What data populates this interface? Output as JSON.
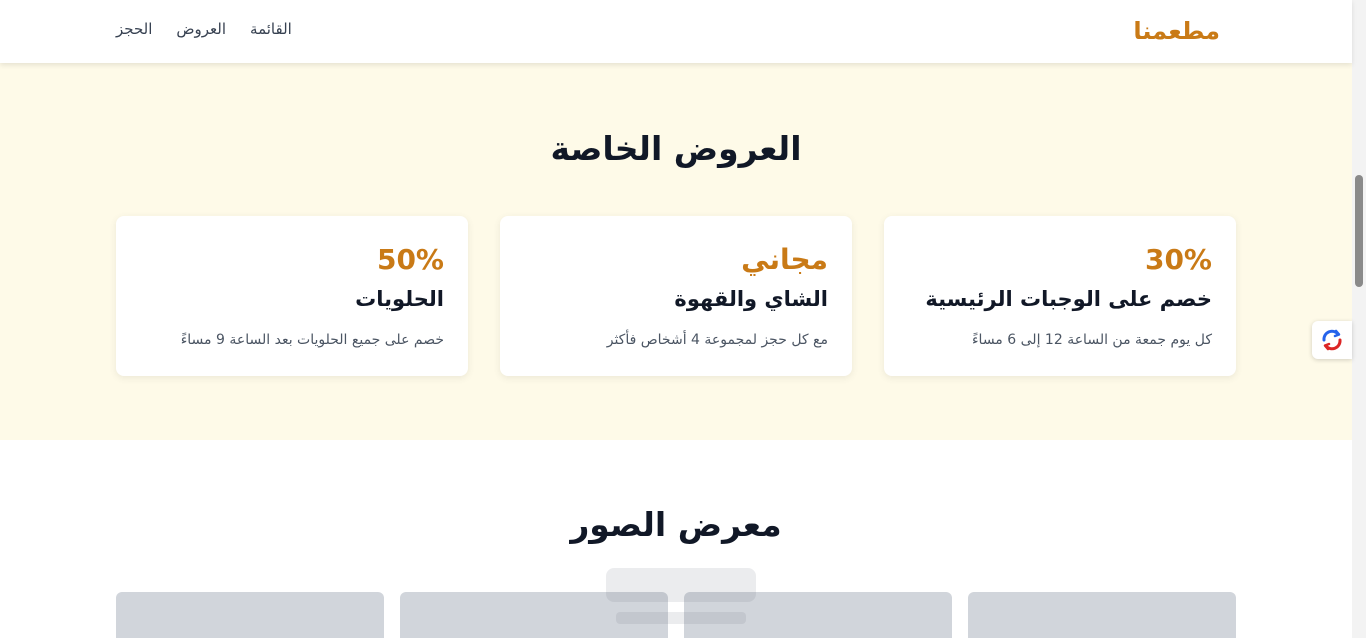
{
  "nav": {
    "brand": "مطعمنا",
    "links": [
      "القائمة",
      "العروض",
      "الحجز"
    ]
  },
  "offers": {
    "title": "العروض الخاصة",
    "cards": [
      {
        "value": "30%",
        "title": "خصم على الوجبات الرئيسية",
        "description": "كل يوم جمعة من الساعة 12 إلى 6 مساءً"
      },
      {
        "value": "مجاني",
        "title": "الشاي والقهوة",
        "description": "مع كل حجز لمجموعة 4 أشخاص فأكثر"
      },
      {
        "value": "50%",
        "title": "الحلويات",
        "description": "خصم على جميع الحلويات بعد الساعة 9 مساءً"
      }
    ]
  },
  "gallery": {
    "title": "معرض الصور"
  },
  "colors": {
    "accent": "#c97a16",
    "offers_background": "#fefae8",
    "thumbnail_placeholder": "#d1d5db"
  },
  "icons": {
    "float_widget": "refresh-sync-icon",
    "watermark": "watermark-logo"
  },
  "scroll": {
    "position_fraction": 0.24
  }
}
